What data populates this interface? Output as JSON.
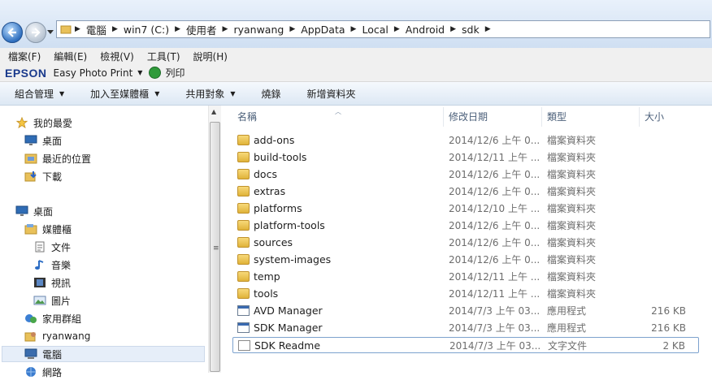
{
  "address": {
    "crumbs": [
      "電腦",
      "win7 (C:)",
      "使用者",
      "ryanwang",
      "AppData",
      "Local",
      "Android",
      "sdk"
    ]
  },
  "menubar": [
    "檔案(F)",
    "編輯(E)",
    "檢視(V)",
    "工具(T)",
    "說明(H)"
  ],
  "epsonbar": {
    "brand": "EPSON",
    "app": "Easy Photo Print",
    "print_label": "列印"
  },
  "commandbar": [
    {
      "label": "組合管理",
      "has_menu": true
    },
    {
      "label": "加入至媒體櫃",
      "has_menu": true
    },
    {
      "label": "共用對象",
      "has_menu": true
    },
    {
      "label": "燒錄",
      "has_menu": false
    },
    {
      "label": "新增資料夾",
      "has_menu": false
    }
  ],
  "navpane": {
    "favorites": {
      "label": "我的最愛",
      "items": [
        "桌面",
        "最近的位置",
        "下載"
      ]
    },
    "desktop": {
      "label": "桌面"
    },
    "libraries": {
      "label": "媒體櫃",
      "items": [
        "文件",
        "音樂",
        "視訊",
        "圖片"
      ]
    },
    "homegroup": "家用群組",
    "user": "ryanwang",
    "computer": "電腦",
    "network": "網路"
  },
  "columns": {
    "name": "名稱",
    "date": "修改日期",
    "type": "類型",
    "size": "大小"
  },
  "files": [
    {
      "name": "add-ons",
      "date": "2014/12/6 上午 0...",
      "type": "檔案資料夾",
      "size": "",
      "kind": "folder"
    },
    {
      "name": "build-tools",
      "date": "2014/12/11 上午 ...",
      "type": "檔案資料夾",
      "size": "",
      "kind": "folder"
    },
    {
      "name": "docs",
      "date": "2014/12/6 上午 0...",
      "type": "檔案資料夾",
      "size": "",
      "kind": "folder"
    },
    {
      "name": "extras",
      "date": "2014/12/6 上午 0...",
      "type": "檔案資料夾",
      "size": "",
      "kind": "folder"
    },
    {
      "name": "platforms",
      "date": "2014/12/10 上午 ...",
      "type": "檔案資料夾",
      "size": "",
      "kind": "folder"
    },
    {
      "name": "platform-tools",
      "date": "2014/12/6 上午 0...",
      "type": "檔案資料夾",
      "size": "",
      "kind": "folder"
    },
    {
      "name": "sources",
      "date": "2014/12/6 上午 0...",
      "type": "檔案資料夾",
      "size": "",
      "kind": "folder"
    },
    {
      "name": "system-images",
      "date": "2014/12/6 上午 0...",
      "type": "檔案資料夾",
      "size": "",
      "kind": "folder"
    },
    {
      "name": "temp",
      "date": "2014/12/11 上午 ...",
      "type": "檔案資料夾",
      "size": "",
      "kind": "folder"
    },
    {
      "name": "tools",
      "date": "2014/12/11 上午 ...",
      "type": "檔案資料夾",
      "size": "",
      "kind": "folder"
    },
    {
      "name": "AVD Manager",
      "date": "2014/7/3 上午 03...",
      "type": "應用程式",
      "size": "216 KB",
      "kind": "app"
    },
    {
      "name": "SDK Manager",
      "date": "2014/7/3 上午 03...",
      "type": "應用程式",
      "size": "216 KB",
      "kind": "app"
    },
    {
      "name": "SDK Readme",
      "date": "2014/7/3 上午 03...",
      "type": "文字文件",
      "size": "2 KB",
      "kind": "doc"
    }
  ]
}
